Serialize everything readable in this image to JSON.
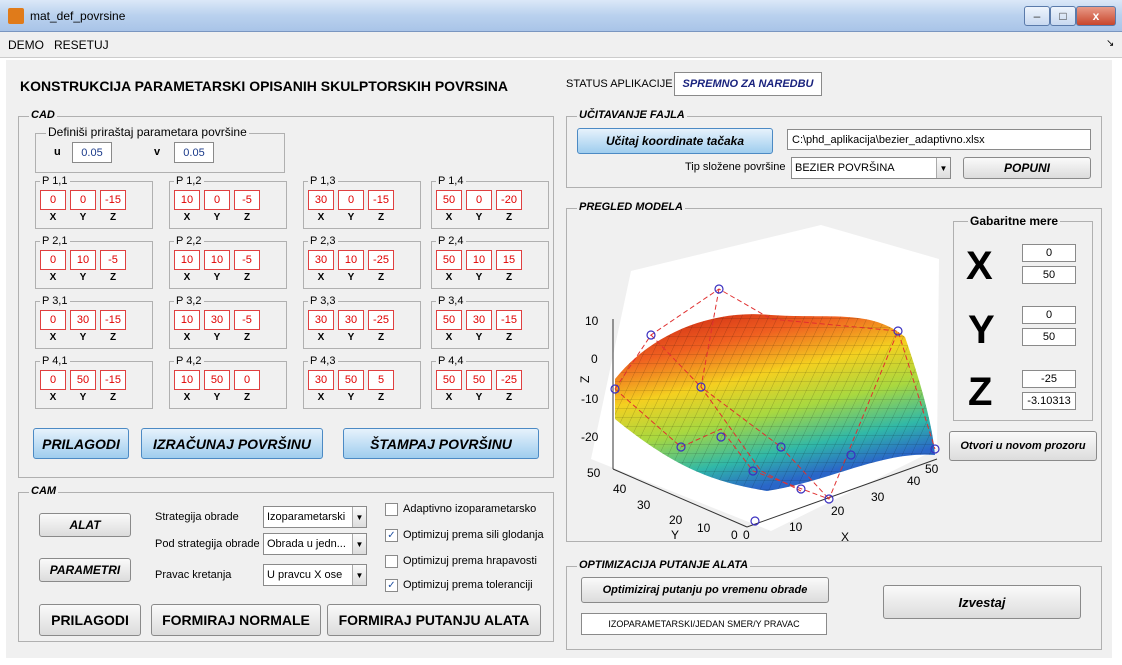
{
  "window": {
    "title": "mat_def_povrsine",
    "min": "–",
    "max": "□",
    "close": "x"
  },
  "menu": {
    "demo": "DEMO",
    "reset": "RESETUJ",
    "dock": "↘"
  },
  "header": {
    "title": "KONSTRUKCIJA PARAMETARSKI OPISANIH SKULPTORSKIH POVRSINA",
    "status_label": "STATUS APLIKACIJE",
    "status_value": "SPREMNO ZA NAREDBU"
  },
  "cad": {
    "title": "CAD",
    "increment": {
      "title": "Definiši priraštaj parametara površine",
      "u_label": "u",
      "u": "0.05",
      "v_label": "v",
      "v": "0.05"
    },
    "points": [
      {
        "name": "P 1,1",
        "x": "0",
        "y": "0",
        "z": "-15"
      },
      {
        "name": "P 1,2",
        "x": "10",
        "y": "0",
        "z": "-5"
      },
      {
        "name": "P 1,3",
        "x": "30",
        "y": "0",
        "z": "-15"
      },
      {
        "name": "P 1,4",
        "x": "50",
        "y": "0",
        "z": "-20"
      },
      {
        "name": "P 2,1",
        "x": "0",
        "y": "10",
        "z": "-5"
      },
      {
        "name": "P 2,2",
        "x": "10",
        "y": "10",
        "z": "-5"
      },
      {
        "name": "P 2,3",
        "x": "30",
        "y": "10",
        "z": "-25"
      },
      {
        "name": "P 2,4",
        "x": "50",
        "y": "10",
        "z": "15"
      },
      {
        "name": "P 3,1",
        "x": "0",
        "y": "30",
        "z": "-15"
      },
      {
        "name": "P 3,2",
        "x": "10",
        "y": "30",
        "z": "-5"
      },
      {
        "name": "P 3,3",
        "x": "30",
        "y": "30",
        "z": "-25"
      },
      {
        "name": "P 3,4",
        "x": "50",
        "y": "30",
        "z": "-15"
      },
      {
        "name": "P 4,1",
        "x": "0",
        "y": "50",
        "z": "-15"
      },
      {
        "name": "P 4,2",
        "x": "10",
        "y": "50",
        "z": "0"
      },
      {
        "name": "P 4,3",
        "x": "30",
        "y": "50",
        "z": "5"
      },
      {
        "name": "P 4,4",
        "x": "50",
        "y": "50",
        "z": "-25"
      }
    ],
    "axes": [
      "X",
      "Y",
      "Z"
    ],
    "btn_adjust": "PRILAGODI",
    "btn_compute": "IZRAČUNAJ POVRŠINU",
    "btn_print": "ŠTAMPAJ POVRŠINU"
  },
  "cam": {
    "title": "CAM",
    "btn_tool": "ALAT",
    "btn_params": "PARAMETRI",
    "strategy_label": "Strategija obrade",
    "strategy_value": "Izoparametarski",
    "substrategy_label": "Pod strategija obrade",
    "substrategy_value": "Obrada u jedn...",
    "direction_label": "Pravac kretanja",
    "direction_value": "U pravcu X ose",
    "checks": [
      {
        "label": "Adaptivno izoparametarsko",
        "checked": false
      },
      {
        "label": "Optimizuj prema sili glodanja",
        "checked": true
      },
      {
        "label": "Optimizuj prema hrapavosti",
        "checked": false
      },
      {
        "label": "Optimizuj prema toleranciji",
        "checked": true
      }
    ],
    "btn_adjust": "PRILAGODI",
    "btn_normals": "FORMIRAJ NORMALE",
    "btn_path": "FORMIRAJ PUTANJU ALATA"
  },
  "file": {
    "title": "UČITAVANJE FAJLA",
    "btn_load": "Učitaj koordinate tačaka",
    "path": "C:\\phd_aplikacija\\bezier_adaptivno.xlsx",
    "type_label": "Tip složene površine",
    "type_value": "BEZIER POVRŠINA",
    "btn_fill": "POPUNI"
  },
  "preview": {
    "title": "PREGLED MODELA",
    "z_label": "Z",
    "x_label": "X",
    "y_label": "Y",
    "z_ticks": [
      "10",
      "0",
      "-10",
      "-20"
    ],
    "y_ticks": [
      "50",
      "40",
      "30",
      "20",
      "10",
      "0"
    ],
    "x_ticks": [
      "0",
      "10",
      "20",
      "30",
      "40",
      "50"
    ],
    "dims": {
      "title": "Gabaritne mere",
      "x_label": "X",
      "x_min": "0",
      "x_max": "50",
      "y_label": "Y",
      "y_min": "0",
      "y_max": "50",
      "z_label": "Z",
      "z_min": "-25",
      "z_max": "-3.10313"
    },
    "btn_open": "Otvori u novom prozoru"
  },
  "optim": {
    "title": "OPTIMIZACIJA PUTANJE ALATA",
    "btn_time": "Optimiziraj putanju po vremenu obrade",
    "btn_report": "Izvestaj",
    "status": "IZOPARAMETARSKI/JEDAN SMER/Y PRAVAC"
  }
}
